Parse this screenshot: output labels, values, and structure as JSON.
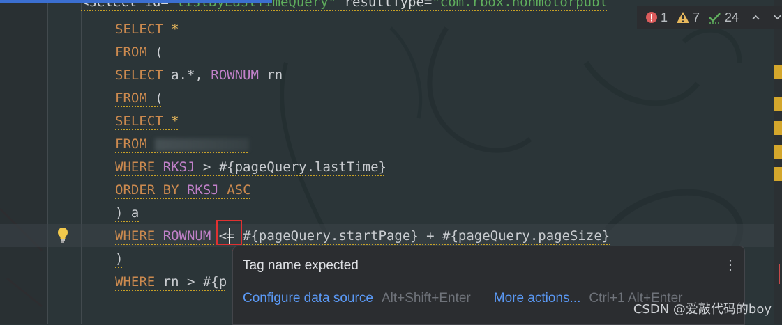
{
  "editor": {
    "lines": [
      {
        "segments": [
          {
            "t": "tag",
            "v": "<select id="
          },
          {
            "t": "attr",
            "v": "\"listByLastTimeQuery\""
          },
          {
            "t": "tag",
            "v": " resultType="
          },
          {
            "t": "attr",
            "v": "\"com.rbox.nonmotorpubl"
          }
        ]
      },
      {
        "segments": [
          {
            "t": "kw",
            "v": "SELECT"
          },
          {
            "t": "plain",
            "v": " "
          },
          {
            "t": "st",
            "v": "*"
          }
        ]
      },
      {
        "segments": [
          {
            "t": "kw",
            "v": "FROM"
          },
          {
            "t": "plain",
            "v": " ("
          }
        ]
      },
      {
        "segments": [
          {
            "t": "kw",
            "v": "SELECT"
          },
          {
            "t": "plain",
            "v": " a.*, "
          },
          {
            "t": "fn",
            "v": "ROWNUM"
          },
          {
            "t": "plain",
            "v": " rn"
          }
        ]
      },
      {
        "segments": [
          {
            "t": "kw",
            "v": "FROM"
          },
          {
            "t": "plain",
            "v": " ("
          }
        ]
      },
      {
        "segments": [
          {
            "t": "kw",
            "v": "SELECT"
          },
          {
            "t": "plain",
            "v": " "
          },
          {
            "t": "st",
            "v": "*"
          }
        ]
      },
      {
        "segments": [
          {
            "t": "kw",
            "v": "FROM"
          },
          {
            "t": "plain",
            "v": " "
          },
          {
            "t": "blur",
            "v": ""
          }
        ]
      },
      {
        "segments": [
          {
            "t": "kw",
            "v": "WHERE"
          },
          {
            "t": "plain",
            "v": " "
          },
          {
            "t": "fn",
            "v": "RKSJ"
          },
          {
            "t": "plain",
            "v": " > #{pageQuery.lastTime}"
          }
        ]
      },
      {
        "segments": [
          {
            "t": "kw",
            "v": "ORDER BY"
          },
          {
            "t": "plain",
            "v": " "
          },
          {
            "t": "fn",
            "v": "RKSJ"
          },
          {
            "t": "plain",
            "v": " "
          },
          {
            "t": "kw",
            "v": "ASC"
          }
        ]
      },
      {
        "segments": [
          {
            "t": "plain",
            "v": ") a"
          }
        ]
      },
      {
        "segments": [
          {
            "t": "kw",
            "v": "WHERE"
          },
          {
            "t": "plain",
            "v": " "
          },
          {
            "t": "fn",
            "v": "ROWNUM"
          },
          {
            "t": "plain",
            "v": " <= #{pageQuery.startPage} + #{pageQuery.pageSize}"
          }
        ]
      },
      {
        "segments": [
          {
            "t": "plain",
            "v": ")"
          }
        ]
      },
      {
        "segments": [
          {
            "t": "kw",
            "v": "WHERE"
          },
          {
            "t": "plain",
            "v": " rn > #{p"
          }
        ]
      }
    ]
  },
  "inspections": {
    "errors": "1",
    "warnings": "7",
    "weak_warnings": "24",
    "colors": {
      "error": "#db5c5c",
      "warning": "#e8b85c",
      "weak": "#5fae5d"
    }
  },
  "popup": {
    "message": "Tag name expected",
    "action1": "Configure data source",
    "action1_shortcut": "Alt+Shift+Enter",
    "action2": "More actions...",
    "action2_shortcut": "Ctrl+1 Alt+Enter"
  },
  "watermark": "CSDN @爱敲代码的boy",
  "icons": {
    "bulb": "lightbulb-icon",
    "error": "error-icon",
    "warning": "warning-icon",
    "weak": "check-icon",
    "up": "chevron-up-icon",
    "down": "chevron-down-icon",
    "more": "kebab-menu-icon"
  }
}
